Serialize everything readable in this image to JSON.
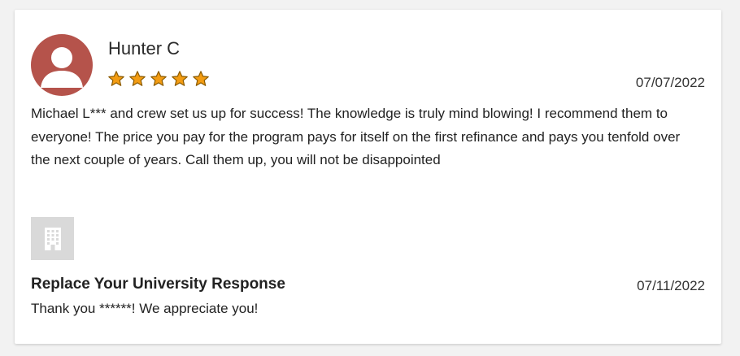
{
  "review": {
    "reviewer_name": "Hunter C",
    "avatar_icon": "user-avatar-icon",
    "avatar_color": "#b5534b",
    "rating": 5,
    "rating_max": 5,
    "star_color": "#f39c12",
    "date": "07/07/2022",
    "text": "Michael L*** and crew set us up for success! The knowledge is truly mind blowing! I recommend them to everyone! The price you pay for the program pays for itself on the first refinance and pays you tenfold over the next couple of years. Call them up, you will not be disappointed"
  },
  "response": {
    "logo_icon": "building-icon",
    "title": "Replace Your University Response",
    "date": "07/11/2022",
    "text": "Thank you ******! We appreciate you!"
  }
}
